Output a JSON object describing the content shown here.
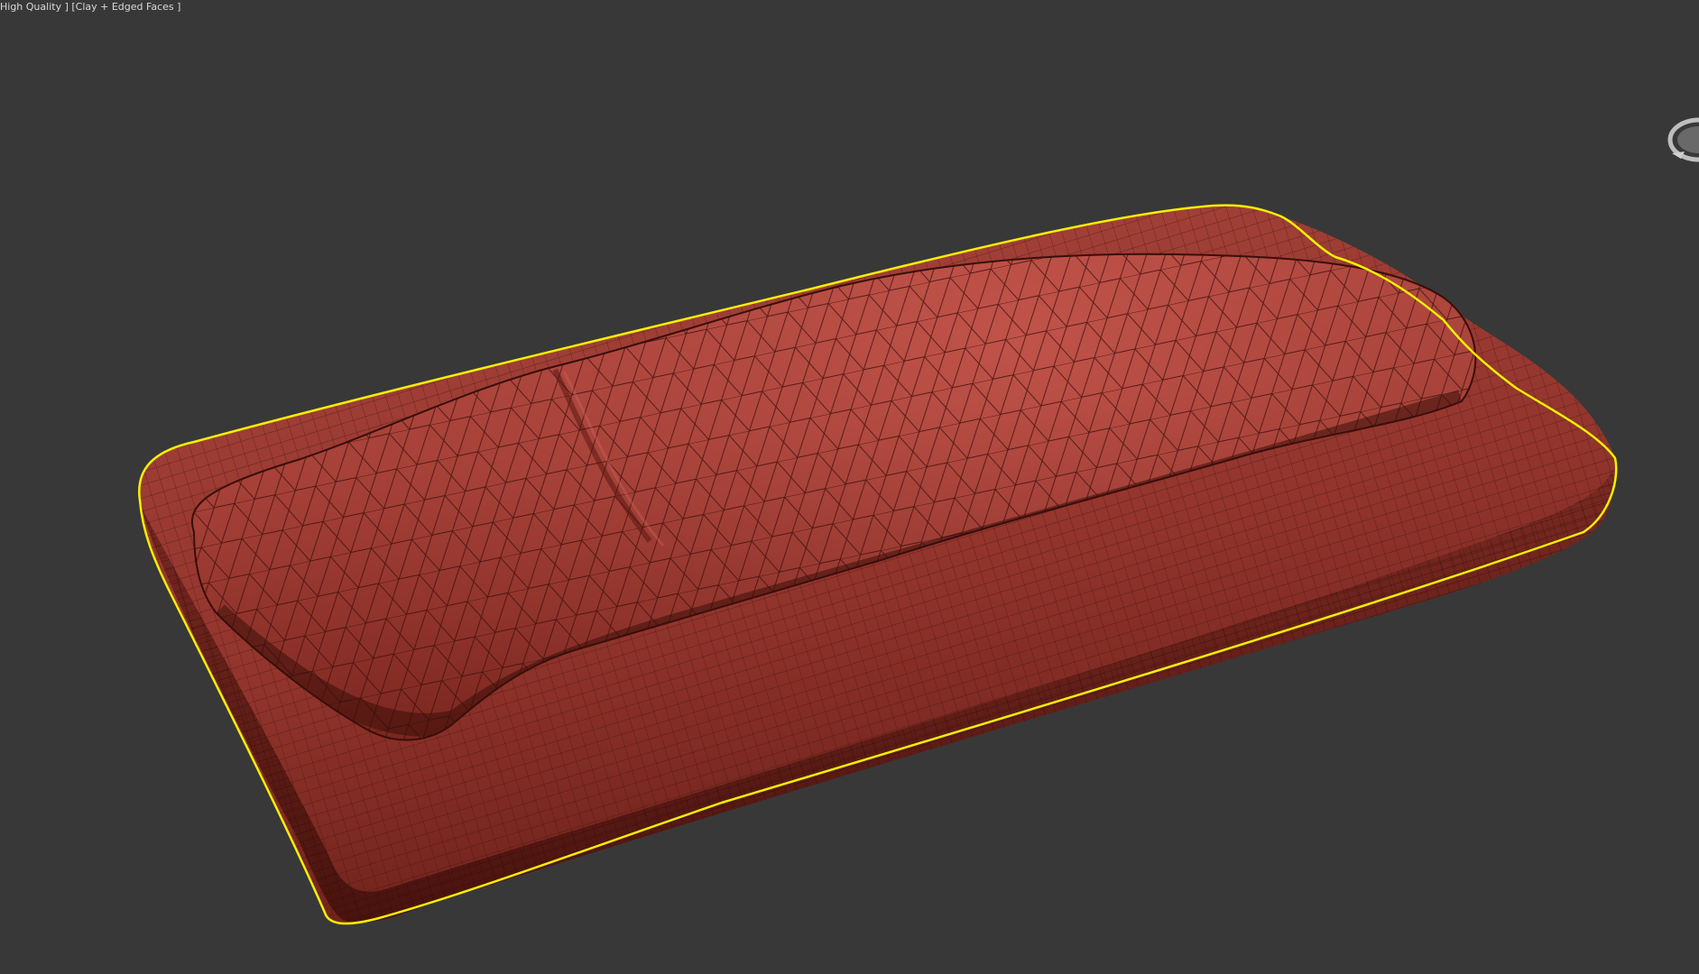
{
  "viewport": {
    "label": "High Quality ] [Clay + Edged Faces ]",
    "background_color": "#383838"
  },
  "scene": {
    "object_color": "#b8483d",
    "selection_outline_color": "#f4f000",
    "wire_color": "#3a0f0b"
  },
  "viewcube": {
    "icon": "viewcube-icon"
  }
}
